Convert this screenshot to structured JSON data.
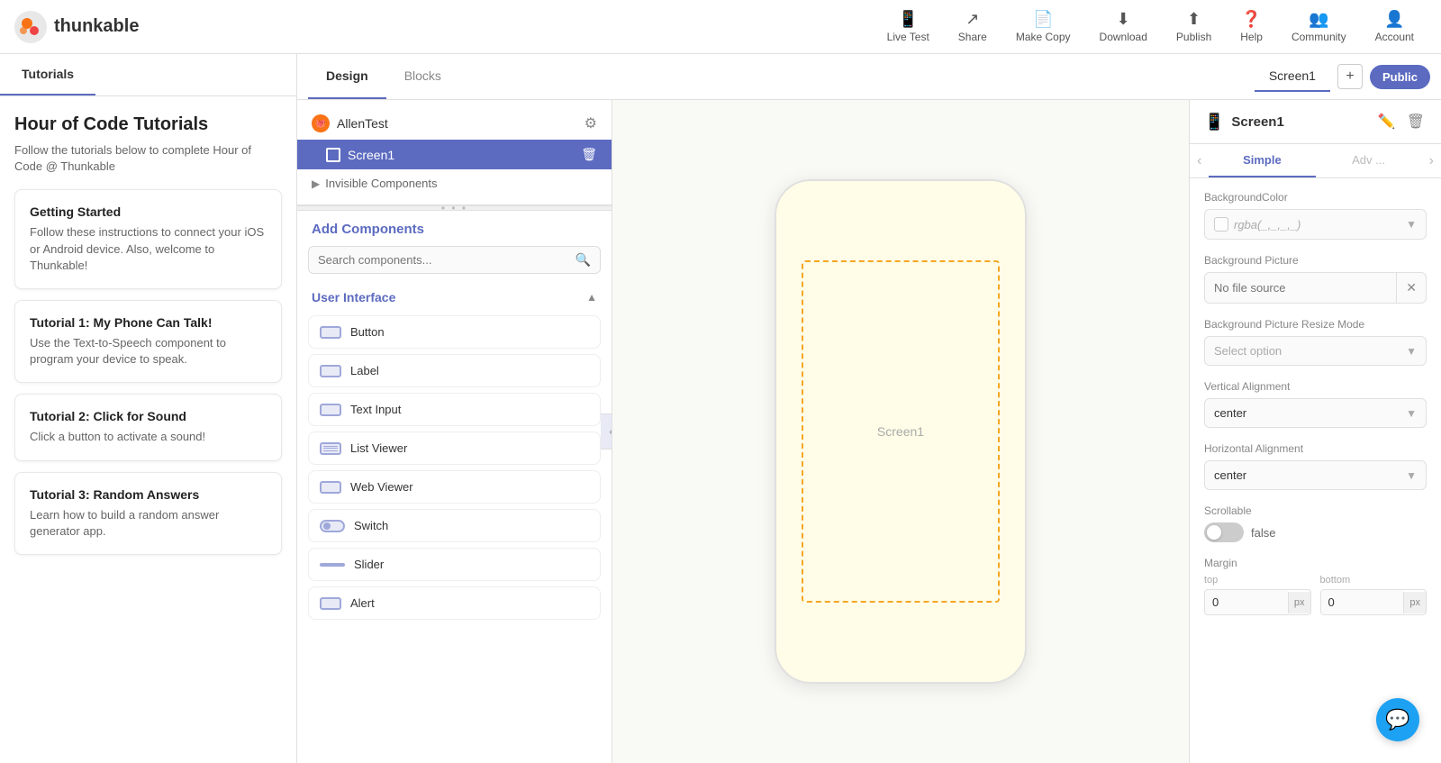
{
  "app": {
    "name": "thunkable",
    "logo_emoji": "🐙"
  },
  "nav": {
    "live_test": "Live Test",
    "share": "Share",
    "make_copy": "Make Copy",
    "download": "Download",
    "publish": "Publish",
    "help": "Help",
    "community": "Community",
    "account": "Account"
  },
  "editor": {
    "design_tab": "Design",
    "blocks_tab": "Blocks",
    "screen_name": "Screen1",
    "public_label": "Public",
    "add_screen_icon": "+"
  },
  "component_panel": {
    "app_name": "AllenTest",
    "screen_item": "Screen1",
    "invisible_label": "Invisible Components",
    "add_components_title": "Add Components",
    "search_placeholder": "Search components...",
    "ui_section": "User Interface",
    "components": [
      {
        "label": "Button",
        "type": "button"
      },
      {
        "label": "Label",
        "type": "label"
      },
      {
        "label": "Text Input",
        "type": "text-input"
      },
      {
        "label": "List Viewer",
        "type": "list"
      },
      {
        "label": "Web Viewer",
        "type": "web"
      },
      {
        "label": "Switch",
        "type": "switch"
      },
      {
        "label": "Slider",
        "type": "slider"
      },
      {
        "label": "Alert",
        "type": "alert"
      }
    ]
  },
  "phone_preview": {
    "screen_label": "Screen1"
  },
  "right_panel": {
    "title": "Screen1",
    "simple_tab": "Simple",
    "advanced_tab_prefix": "Adv",
    "props": {
      "background_color_label": "BackgroundColor",
      "background_color_value": "rgba(_,_,_,_)",
      "background_picture_label": "Background Picture",
      "background_picture_placeholder": "No file source",
      "bg_picture_resize_label": "Background Picture Resize Mode",
      "bg_picture_resize_placeholder": "Select option",
      "vertical_alignment_label": "Vertical Alignment",
      "vertical_alignment_value": "center",
      "horizontal_alignment_label": "Horizontal Alignment",
      "horizontal_alignment_value": "center",
      "scrollable_label": "Scrollable",
      "scrollable_value": "false",
      "margin_label": "Margin",
      "margin_top_label": "top",
      "margin_top_value": "0",
      "margin_bottom_label": "bottom",
      "margin_bottom_value": "0",
      "margin_unit": "px"
    }
  },
  "tutorials": {
    "tab_label": "Tutorials",
    "title": "Hour of Code Tutorials",
    "subtitle": "Follow the tutorials below to complete Hour of Code @ Thunkable",
    "cards": [
      {
        "title": "Getting Started",
        "desc": "Follow these instructions to connect your iOS or Android device. Also, welcome to Thunkable!"
      },
      {
        "title": "Tutorial 1: My Phone Can Talk!",
        "desc": "Use the Text-to-Speech component to program your device to speak."
      },
      {
        "title": "Tutorial 2: Click for Sound",
        "desc": "Click a button to activate a sound!"
      },
      {
        "title": "Tutorial 3: Random Answers",
        "desc": "Learn how to build a random answer generator app."
      }
    ]
  },
  "chat_fab": {
    "icon": "💬"
  }
}
